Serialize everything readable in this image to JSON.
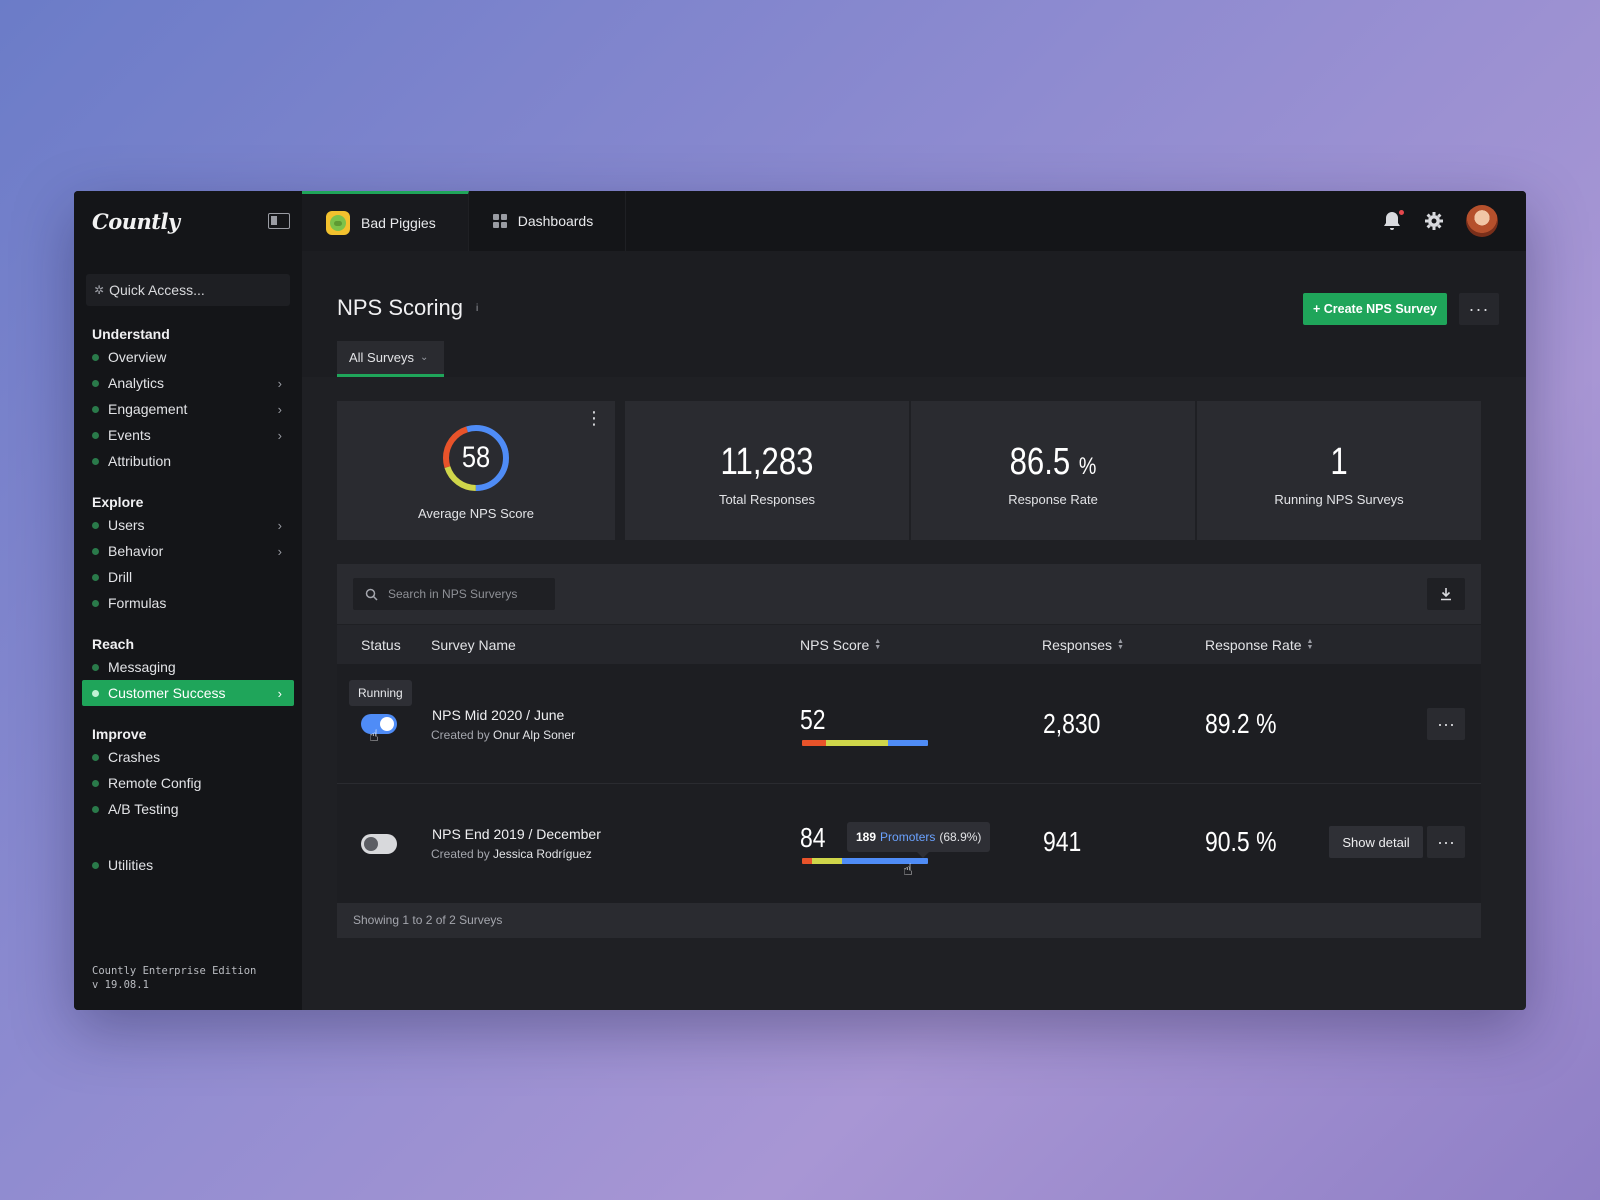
{
  "sidebar": {
    "logo": "Countly",
    "quick_access": "Quick Access...",
    "sections": [
      {
        "heading": "Understand",
        "items": [
          {
            "label": "Overview",
            "chevron": false
          },
          {
            "label": "Analytics",
            "chevron": true
          },
          {
            "label": "Engagement",
            "chevron": true
          },
          {
            "label": "Events",
            "chevron": true
          },
          {
            "label": "Attribution",
            "chevron": false
          }
        ]
      },
      {
        "heading": "Explore",
        "items": [
          {
            "label": "Users",
            "chevron": true
          },
          {
            "label": "Behavior",
            "chevron": true
          },
          {
            "label": "Drill",
            "chevron": false
          },
          {
            "label": "Formulas",
            "chevron": false
          }
        ]
      },
      {
        "heading": "Reach",
        "items": [
          {
            "label": "Messaging",
            "chevron": false
          },
          {
            "label": "Customer Success",
            "chevron": true,
            "active": true
          }
        ]
      },
      {
        "heading": "Improve",
        "items": [
          {
            "label": "Crashes",
            "chevron": false
          },
          {
            "label": "Remote Config",
            "chevron": false
          },
          {
            "label": "A/B Testing",
            "chevron": false
          }
        ]
      }
    ],
    "utilities": "Utilities",
    "footer_edition": "Countly Enterprise Edition",
    "footer_version": "v 19.08.1"
  },
  "topbar": {
    "app_name": "Bad Piggies",
    "dashboards": "Dashboards",
    "icons": [
      "bell-icon",
      "gear-icon",
      "avatar"
    ]
  },
  "page": {
    "title": "NPS Scoring",
    "info": "i",
    "create_button": "+ Create NPS Survey",
    "more": "···",
    "filter_tab": "All Surveys"
  },
  "stats": {
    "avg_nps": {
      "value": "58",
      "label": "Average NPS Score",
      "segments": {
        "detractors": 0.25,
        "passives": 0.2,
        "promoters": 0.55
      }
    },
    "total_responses": {
      "value": "11,283",
      "label": "Total Responses"
    },
    "response_rate": {
      "value": "86.5",
      "unit": "%",
      "label": "Response Rate"
    },
    "running_surveys": {
      "value": "1",
      "label": "Running NPS Surveys"
    }
  },
  "table": {
    "search_placeholder": "Search in NPS Surverys",
    "columns": [
      "Status",
      "Survey Name",
      "NPS Score",
      "Responses",
      "Response Rate"
    ],
    "rows": [
      {
        "status": "Running",
        "on": true,
        "name": "NPS Mid 2020 / June",
        "created_prefix": "Created by",
        "created_by": "Onur Alp Soner",
        "nps": "52",
        "bar": {
          "detractors": 0.19,
          "passives": 0.49,
          "promoters": 0.32
        },
        "responses": "2,830",
        "rate": "89.2 %"
      },
      {
        "status": "Stopped",
        "on": false,
        "name": "NPS End 2019 / December",
        "created_prefix": "Created by",
        "created_by": "Jessica Rodríguez",
        "nps": "84",
        "bar": {
          "detractors": 0.08,
          "passives": 0.24,
          "promoters": 0.68
        },
        "responses": "941",
        "rate": "90.5 %",
        "show_detail": "Show detail",
        "tooltip": {
          "count": "189",
          "label": "Promoters",
          "pct": "(68.9%)"
        }
      }
    ],
    "footer": "Showing 1 to 2 of 2 Surveys"
  },
  "colors": {
    "accent": "#1fa55a",
    "detractors": "#e8532a",
    "passives": "#cfd64a",
    "promoters": "#4f8cf6"
  }
}
